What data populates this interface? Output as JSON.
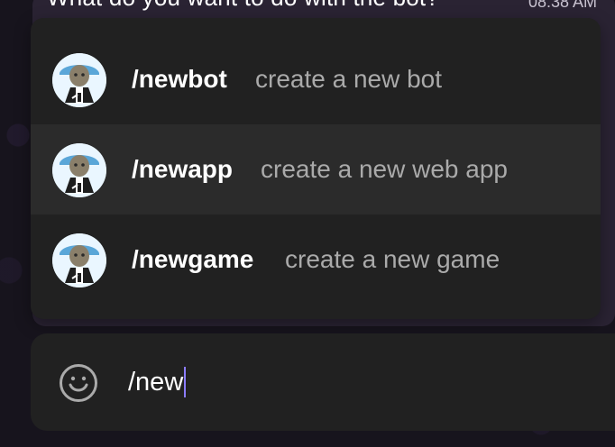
{
  "message": {
    "text": "What do you want to do with the bot?",
    "time": "08:38 AM"
  },
  "commands": [
    {
      "name": "/newbot",
      "description": "create a new bot"
    },
    {
      "name": "/newapp",
      "description": "create a new web app"
    },
    {
      "name": "/newgame",
      "description": "create a new game"
    }
  ],
  "composer": {
    "value": "/new",
    "emoji_icon": "emoji-icon"
  }
}
